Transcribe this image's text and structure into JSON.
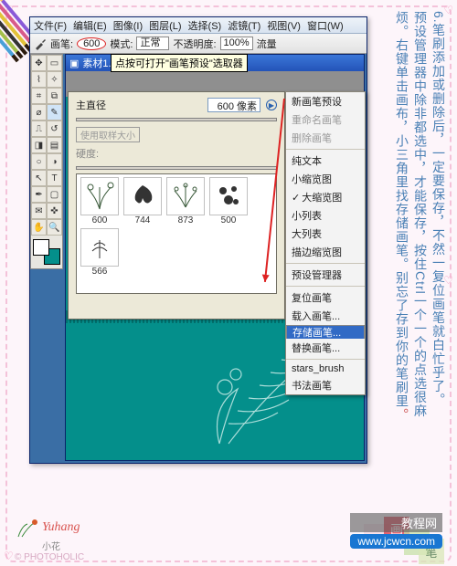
{
  "side_text": {
    "num": "6.",
    "a": "笔刷添加或删除后，一定要保存，不然一复位画笔就白忙乎了。",
    "b": "预设管理器中除非都选中，才能保存，按住Ctrl一个一个的点选很麻",
    "c": "烦。右键单击画布，小三角里找存储画笔。别忘了存到你的笔刷里",
    "d": "。"
  },
  "menus": [
    "文件(F)",
    "编辑(E)",
    "图像(I)",
    "图层(L)",
    "选择(S)",
    "滤镜(T)",
    "视图(V)",
    "窗口(W)"
  ],
  "toolbar": {
    "brush_label": "画笔:",
    "brush_size": "600",
    "mode_label": "模式:",
    "mode_value": "正常",
    "opacity_label": "不透明度:",
    "opacity_value": "100%",
    "flow_label": "流量"
  },
  "tooltip": "点按可打开\"画笔预设\"选取器",
  "doc_title": "素材1.gif @ 100% (图层 3,RGB/8)",
  "panel": {
    "diameter_label": "主直径",
    "diameter_value": "600 像素",
    "use_sample": "使用取样大小",
    "hardness_label": "硬度:"
  },
  "brushes": [
    {
      "size": "600"
    },
    {
      "size": "744"
    },
    {
      "size": "873"
    },
    {
      "size": "500"
    },
    {
      "size": "566"
    }
  ],
  "ctx": {
    "new": "新画笔预设",
    "rename": "重命名画笔",
    "delete": "删除画笔",
    "text_only": "纯文本",
    "small_thumb": "小缩览图",
    "large_thumb": "大缩览图",
    "small_list": "小列表",
    "large_list": "大列表",
    "stroke_thumb": "描边缩览图",
    "preset_mgr": "预设管理器",
    "reset": "复位画笔",
    "load": "载入画笔...",
    "save": "存储画笔...",
    "replace": "替换画笔...",
    "stars": "stars_brush",
    "calli": "书法画笔"
  },
  "signature": "Yuhang",
  "sig_small": "小花",
  "photoholic": "© PHOTOHOLIC",
  "hua": "画",
  "bi": "笔",
  "wm1": "教程网",
  "wm2": "www.jcwcn.com"
}
